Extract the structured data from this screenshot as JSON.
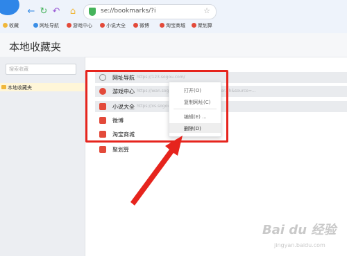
{
  "browser": {
    "url": "se://bookmarks/?i",
    "bookmarks_bar": [
      {
        "label": "收藏",
        "color": "#f0b73b"
      },
      {
        "label": "网址导航",
        "color": "#3a8ee6"
      },
      {
        "label": "游戏中心",
        "color": "#e34a3a"
      },
      {
        "label": "小说大全",
        "color": "#e34a3a"
      },
      {
        "label": "微博",
        "color": "#e34a3a"
      },
      {
        "label": "淘宝商城",
        "color": "#e34a3a"
      },
      {
        "label": "聚划算",
        "color": "#e34a3a"
      }
    ]
  },
  "page": {
    "title": "本地收藏夹",
    "search_placeholder": "搜索收藏",
    "sidebar_selected": "本地收藏夹"
  },
  "bookmarks": [
    {
      "name": "网址导航",
      "url": "https://123.sogou.com/",
      "icon": "globe-icon",
      "color": "#888888"
    },
    {
      "name": "游戏中心",
      "url": "https://wan.sogou.com/?fr=sogou.browser.dh&source=...",
      "icon": "game-center-icon",
      "color": "#e34a3a"
    },
    {
      "name": "小说大全",
      "url": "https://xs.sogou.com/?fr=...",
      "icon": "novel-icon",
      "color": "#e34a3a"
    },
    {
      "name": "微博",
      "url": "",
      "icon": "weibo-icon",
      "color": "#e34a3a"
    },
    {
      "name": "淘宝商城",
      "url": "",
      "icon": "taobao-icon",
      "color": "#e34a3a"
    },
    {
      "name": "聚划算",
      "url": "",
      "icon": "juhuasuan-icon",
      "color": "#e34a3a"
    }
  ],
  "context_menu": {
    "items": [
      {
        "label": "打开(O)",
        "highlighted": false
      },
      {
        "label": "复制网址(C)",
        "highlighted": false
      },
      {
        "label": "编辑(E) ...",
        "highlighted": false
      },
      {
        "label": "删除(D)",
        "highlighted": true
      }
    ]
  },
  "annotation": {
    "color": "#e6241d"
  },
  "watermark": {
    "brand": "Bai du 经验",
    "url": "jingyan.baidu.com"
  }
}
